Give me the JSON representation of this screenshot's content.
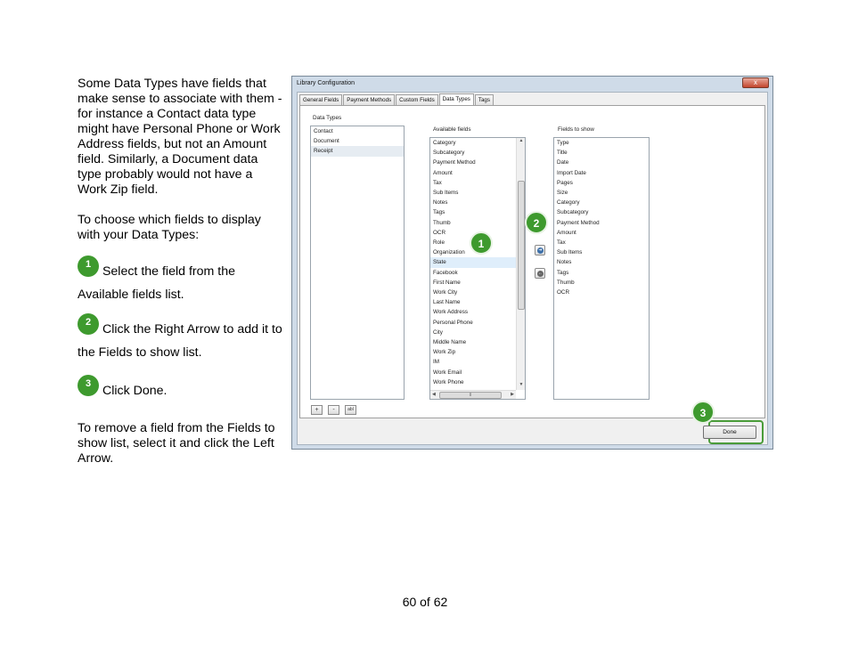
{
  "instructions": {
    "paragraph_1": "Some Data Types have fields that make sense to associate with them - for instance a Contact data type might have Personal Phone or Work Address fields, but not an Amount field. Similarly, a Document data type probably would not have a Work Zip field.",
    "paragraph_2": "To choose which fields to display with your Data Types:",
    "steps": [
      {
        "badge": "1",
        "text": " Select the field from the Available fields list."
      },
      {
        "badge": "2",
        "text": " Click the Right Arrow to add it to the Fields to show list."
      },
      {
        "badge": "3",
        "text": " Click Done."
      }
    ],
    "paragraph_end": "To remove a field from the Fields to show list, select it and click the Left Arrow."
  },
  "window": {
    "title": "Library Configuration",
    "close_glyph": "x",
    "tabs": [
      "General Fields",
      "Payment Methods",
      "Custom Fields",
      "Data Types",
      "Tags"
    ],
    "active_tab": "Data Types",
    "data_types_label": "Data Types",
    "data_types": [
      "Contact",
      "Document",
      "Receipt"
    ],
    "selected_data_type": "Receipt",
    "available_label": "Available fields",
    "available_fields": [
      "Category",
      "Subcategory",
      "Payment Method",
      "Amount",
      "Tax",
      "Sub Items",
      "Notes",
      "Tags",
      "Thumb",
      "OCR",
      "Role",
      "Organization",
      "State",
      "Facebook",
      "First Name",
      "Work City",
      "Last Name",
      "Work Address",
      "Personal Phone",
      "City",
      "Middle Name",
      "Work Zip",
      "IM",
      "Work Email",
      "Work Phone"
    ],
    "selected_available": "State",
    "fields_to_show_label": "Fields to show",
    "fields_to_show": [
      "Type",
      "Title",
      "Date",
      "Import Date",
      "Pages",
      "Size",
      "Category",
      "Subcategory",
      "Payment Method",
      "Amount",
      "Tax",
      "Sub Items",
      "Notes",
      "Tags",
      "Thumb",
      "OCR"
    ],
    "add_button": "+",
    "remove_button": "-",
    "rename_button": "abl",
    "done_button": "Done",
    "callouts": [
      "1",
      "2",
      "3"
    ]
  },
  "page_number": "60 of 62",
  "colors": {
    "accent_green": "#3e9a2e",
    "window_frame": "#cfdbe8"
  }
}
